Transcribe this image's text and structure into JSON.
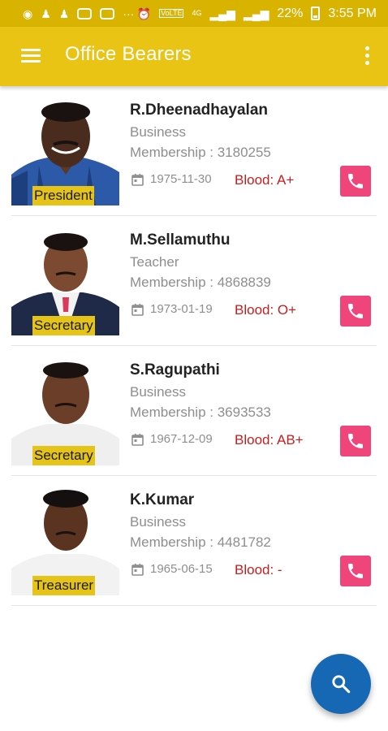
{
  "status_bar": {
    "battery": "22%",
    "time": "3:55 PM",
    "volte": "VoLTE",
    "network": "4G"
  },
  "app_bar": {
    "title": "Office Bearers"
  },
  "members": [
    {
      "name": "R.Dheenadhayalan",
      "occupation": "Business",
      "membership": "Membership : 3180255",
      "dob": "1975-11-30",
      "blood": "Blood: A+",
      "role": "President"
    },
    {
      "name": "M.Sellamuthu",
      "occupation": "Teacher",
      "membership": "Membership : 4868839",
      "dob": "1973-01-19",
      "blood": "Blood: O+",
      "role": "Secretary"
    },
    {
      "name": "S.Ragupathi",
      "occupation": "Business",
      "membership": "Membership : 3693533",
      "dob": "1967-12-09",
      "blood": "Blood: AB+",
      "role": "Secretary"
    },
    {
      "name": "K.Kumar",
      "occupation": "Business",
      "membership": "Membership : 4481782",
      "dob": "1965-06-15",
      "blood": "Blood: -",
      "role": "Treasurer"
    }
  ],
  "icons": {
    "menu": "menu-icon",
    "overflow": "more-vert-icon",
    "calendar": "calendar-icon",
    "call": "phone-icon",
    "fab": "search-icon"
  },
  "colors": {
    "status_bar": "#d8b300",
    "app_bar": "#e9c414",
    "role_label": "#e6c417",
    "call_button": "#f0457b",
    "blood_text": "#c81d1d",
    "fab": "#1668b4"
  }
}
